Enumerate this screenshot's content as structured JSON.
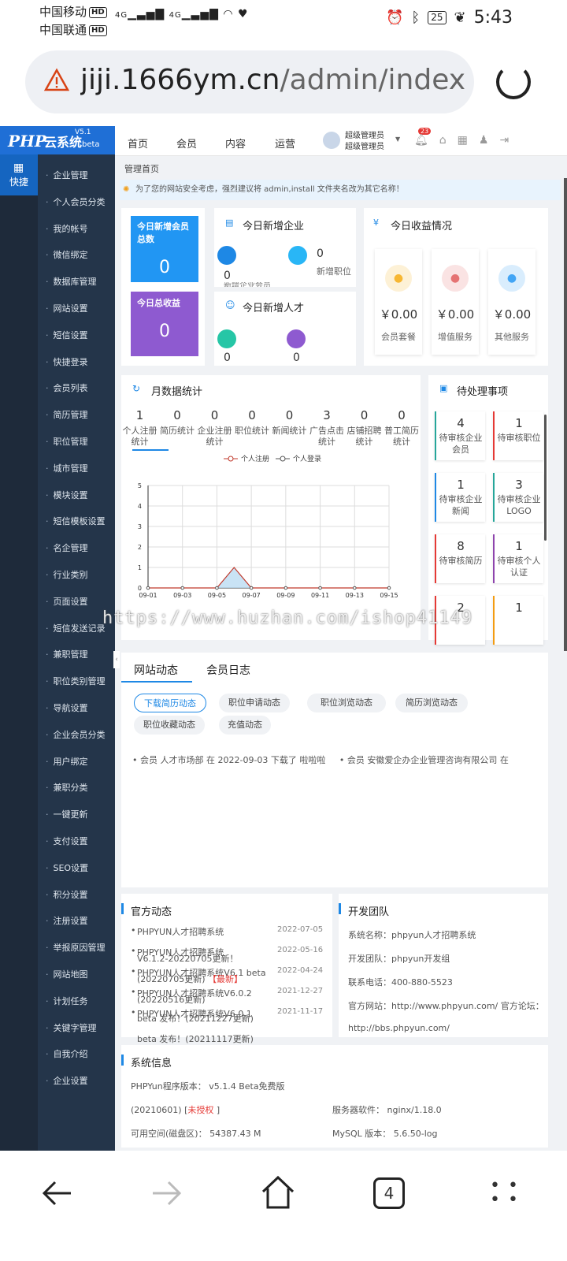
{
  "status": {
    "carrier1": "中国移动",
    "carrier2": "中国联通",
    "hd": "HD",
    "signal1": "4G",
    "signal2": "4G",
    "battery": "25",
    "time": "5:43"
  },
  "browser": {
    "url_host": "jiji.1666ym.cn",
    "url_path": "/admin/index.ph"
  },
  "logo": {
    "php": "PHP",
    "yun": "云系统",
    "ver": "V5.1",
    "beta": "beta"
  },
  "topnav": {
    "items": [
      "首页",
      "会员",
      "内容",
      "运营"
    ],
    "admin_line1": "超级管理员",
    "admin_line2": "超级管理员",
    "badge": "23"
  },
  "leftbar": {
    "quick": "快捷"
  },
  "menu": [
    "企业管理",
    "个人会员分类",
    "我的帐号",
    "微信绑定",
    "数据库管理",
    "网站设置",
    "短信设置",
    "快捷登录",
    "会员列表",
    "简历管理",
    "职位管理",
    "城市管理",
    "模块设置",
    "短信模板设置",
    "名企管理",
    "行业类别",
    "页面设置",
    "短信发送记录",
    "兼职管理",
    "职位类别管理",
    "导航设置",
    "企业会员分类",
    "用户绑定",
    "兼职分类",
    "一键更新",
    "支付设置",
    "SEO设置",
    "积分设置",
    "注册设置",
    "举报原因管理",
    "网站地图",
    "计划任务",
    "关键字管理",
    "自我介绍",
    "企业设置"
  ],
  "crumb": "管理首页",
  "notice": "为了您的网站安全考虑，强烈建议将 admin,install 文件夹名改为其它名称！",
  "today": {
    "new_members_label": "今日新增会员总数",
    "new_members_value": "0",
    "income_label": "今日总收益",
    "income_value": "0"
  },
  "new_company": {
    "title": "今日新增企业",
    "left_value": "0",
    "right_value": "0",
    "right_label": "新增职位",
    "cut_label": "新增企业会员"
  },
  "new_talent": {
    "title": "今日新增人才",
    "left_value": "0",
    "right_value": "0"
  },
  "revenue": {
    "title": "今日收益情况",
    "items": [
      {
        "value": "￥0.00",
        "label": "会员套餐"
      },
      {
        "value": "￥0.00",
        "label": "增值服务"
      },
      {
        "value": "￥0.00",
        "label": "其他服务"
      }
    ]
  },
  "monthly": {
    "title": "月数据统计",
    "stats": [
      {
        "value": "1",
        "label": "个人注册统计"
      },
      {
        "value": "0",
        "label": "简历统计"
      },
      {
        "value": "0",
        "label": "企业注册统计"
      },
      {
        "value": "0",
        "label": "职位统计"
      },
      {
        "value": "0",
        "label": "新闻统计"
      },
      {
        "value": "3",
        "label": "广告点击统计"
      },
      {
        "value": "0",
        "label": "店铺招聘统计"
      },
      {
        "value": "0",
        "label": "普工简历统计"
      }
    ]
  },
  "chart_data": {
    "type": "line",
    "legend": [
      "个人注册",
      "个人登录"
    ],
    "x": [
      "09-01",
      "09-03",
      "09-05",
      "09-07",
      "09-09",
      "09-11",
      "09-13",
      "09-15"
    ],
    "series": [
      {
        "name": "个人注册",
        "color": "#c0392b",
        "points": [
          [
            0,
            0
          ],
          [
            1,
            0
          ],
          [
            2,
            0
          ],
          [
            2.5,
            1
          ],
          [
            3,
            0
          ],
          [
            4,
            0
          ],
          [
            5,
            0
          ],
          [
            6,
            0
          ],
          [
            7,
            0
          ]
        ]
      },
      {
        "name": "个人登录",
        "color": "#555555",
        "points": [
          [
            0,
            0
          ],
          [
            1,
            0
          ],
          [
            2,
            0
          ],
          [
            3,
            0
          ],
          [
            4,
            0
          ],
          [
            5,
            0
          ],
          [
            6,
            0
          ],
          [
            7,
            0
          ]
        ]
      }
    ],
    "ylim": [
      0,
      5
    ],
    "yticks": [
      "0",
      "1",
      "2",
      "3",
      "4",
      "5"
    ]
  },
  "pending": {
    "title": "待处理事项",
    "items": [
      {
        "value": "4",
        "label": "待审核企业会员",
        "color": "#26a69a"
      },
      {
        "value": "1",
        "label": "待审核职位",
        "color": "#e53935"
      },
      {
        "value": "1",
        "label": "待审核企业新闻",
        "color": "#1e88e5"
      },
      {
        "value": "3",
        "label": "待审核企业LOGO",
        "color": "#26a69a"
      },
      {
        "value": "8",
        "label": "待审核简历",
        "color": "#e53935"
      },
      {
        "value": "1",
        "label": "待审核个人认证",
        "color": "#8e44ad"
      },
      {
        "value": "2",
        "label": "",
        "color": "#e53935"
      },
      {
        "value": "1",
        "label": "",
        "color": "#f39c12"
      }
    ]
  },
  "activity": {
    "tabs": [
      "网站动态",
      "会员日志"
    ],
    "pills": [
      "下载简历动态",
      "职位申请动态",
      "职位浏览动态",
      "简历浏览动态",
      "职位收藏动态",
      "充值动态"
    ],
    "feed": [
      "会员 人才市场部 在 2022-09-03 下载了 啦啦啦",
      "会员 安徽爱企办企业管理咨询有限公司 在"
    ]
  },
  "official": {
    "title": "官方动态",
    "items": [
      {
        "text": "PHPYUN人才招聘系统",
        "date": "2022-07-05"
      },
      {
        "text": "PHPYUN人才招聘系统",
        "date": "2022-05-16"
      },
      {
        "text": "V6.1.2-20220705更新！",
        "date": ""
      },
      {
        "text": "PHPYUN人才招聘系统V6.1 beta",
        "date": "2022-04-24"
      },
      {
        "text": "(20220705更新)",
        "date": ""
      },
      {
        "text": "【最新】",
        "date": ""
      },
      {
        "text": "PHPYUN人才招聘系统V6.0.2",
        "date": "2021-12-27"
      },
      {
        "text": "(20220516更新)",
        "date": ""
      },
      {
        "text": "PHPYUN人才招聘系统V6.0.1",
        "date": "2021-11-17"
      },
      {
        "text": "beta 发布！(20211227更新)",
        "date": ""
      },
      {
        "text": "beta 发布！(20211117更新)",
        "date": ""
      }
    ]
  },
  "devteam": {
    "title": "开发团队",
    "name": "系统名称：phpyun人才招聘系统",
    "team": "开发团队：phpyun开发组",
    "phone": "联系电话：400-880-5523",
    "site": "官方网站：http://www.phpyun.com/ 官方论坛：",
    "forum": "http://bbs.phpyun.com/"
  },
  "sysinfo": {
    "title": "系统信息",
    "version": "PHPYun程序版本： v5.1.4 Beta免费版",
    "build": "(20210601) [",
    "unauth": "未授权",
    "build_end": " ]",
    "server": "服务器软件：  nginx/1.18.0",
    "disk": "可用空间(磁盘区)：  54387.43 M",
    "mysql": "MySQL 版本：  5.6.50-log"
  },
  "bottomnav": {
    "tabs": "4"
  },
  "watermark": "https://www.huzhan.com/ishop41149"
}
